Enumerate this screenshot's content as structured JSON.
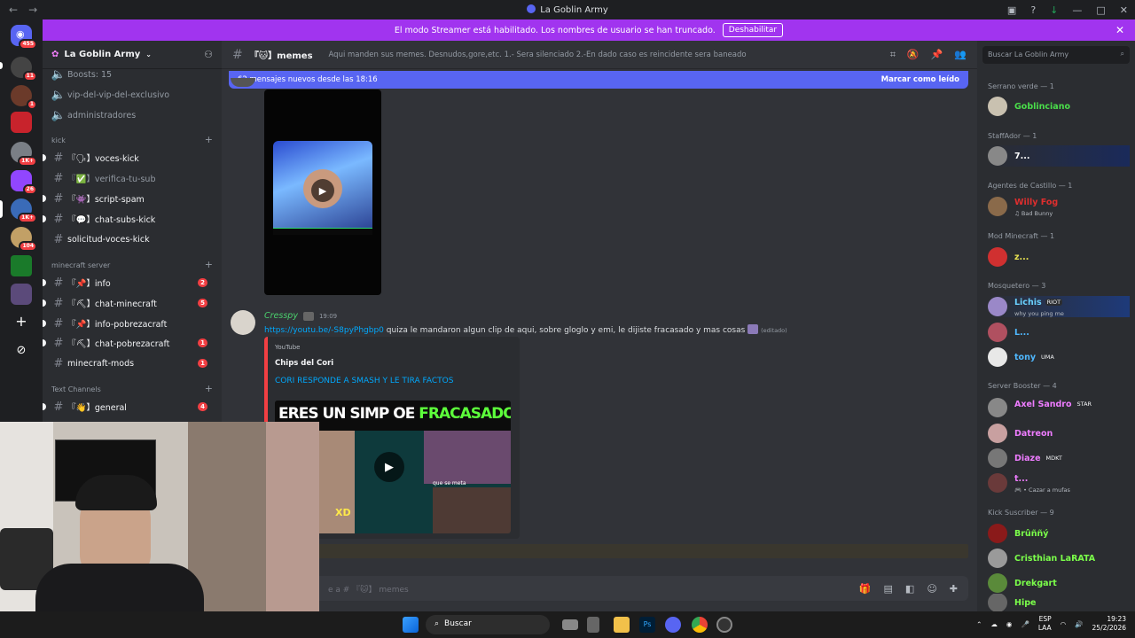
{
  "window": {
    "title": "La Goblin Army"
  },
  "banner": {
    "text": "El modo Streamer está habilitado. Los nombres de usuario se han truncado.",
    "button": "Deshabilitar"
  },
  "server_badges": {
    "dm": "455",
    "s1": "11",
    "s2": "1",
    "s3": "1K+",
    "s4": "26",
    "s5": "1K+",
    "s6": "104"
  },
  "guild": {
    "name": "La Goblin Army"
  },
  "channels": {
    "boosts": "Boosts: 15",
    "vip": "vip-del-vip-del-exclusivo",
    "admins": "administradores",
    "cat_kick": "kick",
    "voces_kick": "『🗣】voces-kick",
    "verifica": "『✅】verifica-tu-sub",
    "script_spam": "『👾】script-spam",
    "chat_subs_kick": "『💬】chat-subs-kick",
    "solicitud": "solicitud-voces-kick",
    "cat_mc": "minecraft server",
    "info": "『📌】info",
    "info_badge": "2",
    "chat_mc": "『⛏】chat-minecraft",
    "chat_mc_badge": "5",
    "info_pobreza": "『📌】info-pobrezacraft",
    "chat_pobreza": "『⛏】chat-pobrezacraft",
    "chat_pobreza_badge": "1",
    "mc_mods": "minecraft-mods",
    "mc_mods_badge": "1",
    "cat_text": "Text Channels",
    "general": "『👋】general",
    "general_badge": "4"
  },
  "channel": {
    "name": "『🐱】memes",
    "topic": "Aqui manden sus memes. Desnudos,gore,etc. 1.- Sera silenciado 2.-En dado caso es reincidente sera baneado",
    "new_messages": "62 mensajes nuevos desde las 18:16",
    "mark_read": "Marcar como leído"
  },
  "message": {
    "author": "Cresspy",
    "time": "19:09",
    "link": "https://youtu.be/-S8pyPhgbp0",
    "text": " quiza le mandaron algun clip de aqui, sobre gloglo y emi, le dijiste fracasado y mas cosas",
    "edited": "(editado)",
    "embed_provider": "YouTube",
    "embed_author": "Chips del Cori",
    "embed_title": "CORI RESPONDE A SMASH Y LE TIRA FACTOS",
    "thumb_text_1": "ERES UN SIMP OE ",
    "thumb_text_2": "FRACASADO",
    "thumb_xd": "XD",
    "thumb_caption": "que se meta"
  },
  "composer": {
    "placeholder": "e a # 『🐱】 memes"
  },
  "members": {
    "search_placeholder": "Buscar La Goblin Army",
    "r1": "Serrano verde — 1",
    "m1": "Goblinciano",
    "r2": "StaffAdor — 1",
    "m2": "7...",
    "r3": "Agentes de Castillo — 1",
    "m3": "Willy Fog",
    "m3_sub": "♫ Bad Bunny",
    "r4": "Mod Minecraft — 1",
    "m4": "z...",
    "r5": "Mosquetero — 3",
    "m5": "Lichis",
    "m5_tag": "RIOT",
    "m5_sub": "why you ping me",
    "m6": "L...",
    "m7": "tony",
    "m7_tag": "UMA",
    "r6": "Server Booster — 4",
    "m8": "Axel Sandro",
    "m8_tag": "STAR",
    "m9": "Datreon",
    "m10": "Diaze",
    "m10_tag": "MDKT",
    "m11": "t...",
    "m11_sub": "🎮 • Cazar a mufas",
    "r7": "Kick Suscriber — 9",
    "m12": "Brûññý",
    "m13": "Cristhian LaRATA",
    "m14": "Drekgart",
    "m15": "Hipe"
  },
  "taskbar": {
    "search": "Buscar",
    "lang1": "ESP",
    "lang2": "LAA",
    "time": "19:23",
    "date": "25/2/2026"
  }
}
